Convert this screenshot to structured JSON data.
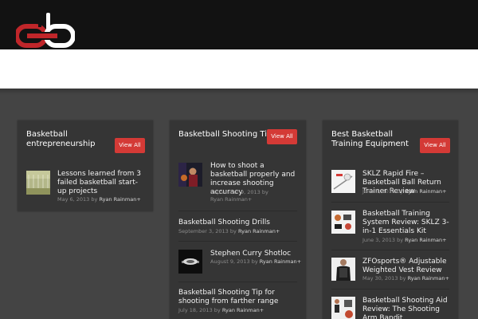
{
  "brand": {
    "logo_alt": "cb"
  },
  "colors": {
    "accent": "#d43a36",
    "header": "#121212",
    "background": "#444444",
    "panel": "#353535"
  },
  "panels": [
    {
      "title": "Basketball entrepreneurship",
      "button": "View All",
      "posts": [
        {
          "title": "Lessons learned from 3 failed basketball start-up projects",
          "date": "May 6, 2013",
          "by": "by",
          "author": "Ryan Rainman+"
        }
      ]
    },
    {
      "title": "Basketball Shooting Tips",
      "button": "View All",
      "posts": [
        {
          "title": "How to shoot a basketball properly and increase shooting accuracy",
          "date": "September 9, 2013",
          "by": "by",
          "author": "Ryan Rainman+"
        },
        {
          "title": "Basketball Shooting Drills",
          "date": "September 3, 2013",
          "by": "by",
          "author": "Ryan Rainman+"
        },
        {
          "title": "Stephen Curry Shotloc",
          "date": "August 9, 2013",
          "by": "by",
          "author": "Ryan Rainman+"
        },
        {
          "title": "Basketball Shooting Tip for shooting from farther range",
          "date": "July 18, 2013",
          "by": "by",
          "author": "Ryan Rainman+"
        }
      ]
    },
    {
      "title": "Best Basketball Training Equipment",
      "button": "View All",
      "posts": [
        {
          "title": "SKLZ Rapid Fire – Basketball Ball Return Trainer Review",
          "date": "June 3, 2013",
          "by": "by",
          "author": "Ryan Rainman+"
        },
        {
          "title": "Basketball Training System Review: SKLZ 3-in-1 Essentials Kit",
          "date": "June 3, 2013",
          "by": "by",
          "author": "Ryan Rainman+"
        },
        {
          "title": "ZFOsports® Adjustable Weighted Vest Review",
          "date": "May 30, 2013",
          "by": "by",
          "author": "Ryan Rainman+"
        },
        {
          "title": "Basketball Shooting Aid Review: The Shooting Arm Bandit",
          "date": "",
          "by": "",
          "author": ""
        }
      ]
    }
  ]
}
